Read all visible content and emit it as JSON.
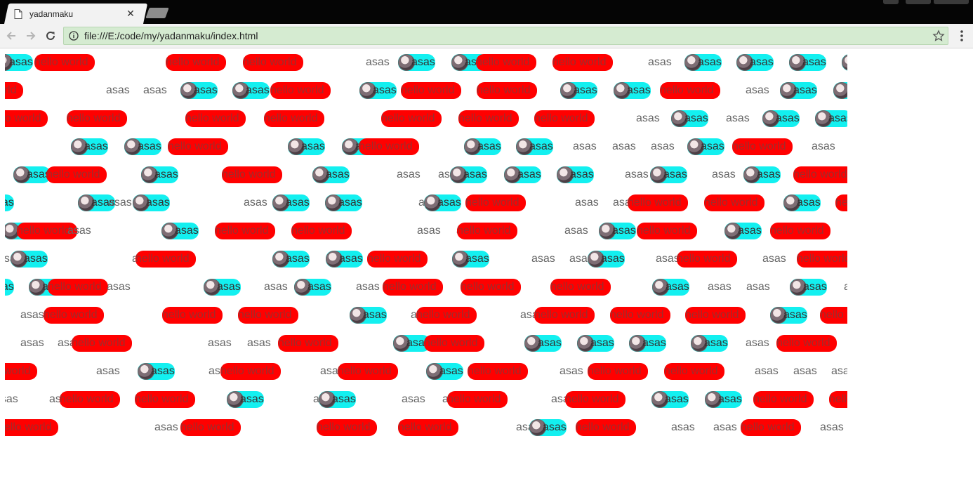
{
  "browser": {
    "tab_title": "yadanmaku",
    "url": "file:///E:/code/my/yadanmaku/index.html",
    "icons": {
      "back": "arrow-left-icon",
      "forward": "arrow-right-icon",
      "reload": "reload-icon",
      "info": "info-icon",
      "star": "star-icon",
      "menu": "menu-icon",
      "close": "close-icon",
      "page": "document-icon"
    },
    "colors": {
      "address_bar": "#d5ebd1"
    }
  },
  "danmaku": {
    "labels": {
      "red": "hello world",
      "cyan": "asas",
      "plain": "asas"
    },
    "colors": {
      "red": "#ff0000",
      "cyan": "#13f0f0",
      "plain_text": "#666666"
    },
    "rows": [
      [
        [
          "c",
          -13
        ],
        [
          "r",
          42
        ],
        [
          "r",
          229
        ],
        [
          "r",
          339
        ],
        [
          "p",
          514
        ],
        [
          "c",
          560
        ],
        [
          "c",
          636
        ],
        [
          "r",
          671
        ],
        [
          "r",
          780
        ],
        [
          "p",
          916
        ],
        [
          "c",
          968
        ],
        [
          "c",
          1042
        ],
        [
          "c",
          1117
        ],
        [
          "c",
          1192
        ]
      ],
      [
        [
          "r",
          -60
        ],
        [
          "p",
          144
        ],
        [
          "p",
          197
        ],
        [
          "c",
          250
        ],
        [
          "c",
          324
        ],
        [
          "r",
          378
        ],
        [
          "c",
          505
        ],
        [
          "r",
          564
        ],
        [
          "r",
          672
        ],
        [
          "c",
          791
        ],
        [
          "c",
          867
        ],
        [
          "r",
          933
        ],
        [
          "p",
          1055
        ],
        [
          "c",
          1104
        ],
        [
          "c",
          1180
        ]
      ],
      [
        [
          "r",
          -25
        ],
        [
          "r",
          88
        ],
        [
          "r",
          257
        ],
        [
          "r",
          369
        ],
        [
          "r",
          536
        ],
        [
          "r",
          646
        ],
        [
          "r",
          754
        ],
        [
          "p",
          899
        ],
        [
          "c",
          949
        ],
        [
          "p",
          1027
        ],
        [
          "c",
          1079
        ],
        [
          "c",
          1154
        ]
      ],
      [
        [
          "c",
          94
        ],
        [
          "c",
          170
        ],
        [
          "r",
          232
        ],
        [
          "c",
          403
        ],
        [
          "c",
          480
        ],
        [
          "r",
          504
        ],
        [
          "c",
          654
        ],
        [
          "c",
          728
        ],
        [
          "p",
          809
        ],
        [
          "p",
          865
        ],
        [
          "p",
          920
        ],
        [
          "c",
          972
        ],
        [
          "r",
          1036
        ],
        [
          "p",
          1149
        ]
      ],
      [
        [
          "c",
          12
        ],
        [
          "r",
          59
        ],
        [
          "c",
          194
        ],
        [
          "r",
          309
        ],
        [
          "c",
          438
        ],
        [
          "p",
          558
        ],
        [
          "p",
          617
        ],
        [
          "c",
          634
        ],
        [
          "c",
          711
        ],
        [
          "c",
          786
        ],
        [
          "p",
          883
        ],
        [
          "c",
          919
        ],
        [
          "p",
          1007
        ],
        [
          "c",
          1052
        ],
        [
          "r",
          1123
        ]
      ],
      [
        [
          "c",
          -40
        ],
        [
          "c",
          104
        ],
        [
          "p",
          147
        ],
        [
          "c",
          182
        ],
        [
          "p",
          340
        ],
        [
          "c",
          381
        ],
        [
          "c",
          456
        ],
        [
          "p",
          589
        ],
        [
          "c",
          597
        ],
        [
          "r",
          656
        ],
        [
          "p",
          812
        ],
        [
          "p",
          866
        ],
        [
          "r",
          887
        ],
        [
          "r",
          996
        ],
        [
          "c",
          1109
        ],
        [
          "r",
          1183
        ]
      ],
      [
        [
          "c",
          -3
        ],
        [
          "r",
          17
        ],
        [
          "p",
          89
        ],
        [
          "c",
          223
        ],
        [
          "r",
          299
        ],
        [
          "r",
          408
        ],
        [
          "p",
          587
        ],
        [
          "p",
          643
        ],
        [
          "r",
          644
        ],
        [
          "p",
          797
        ],
        [
          "c",
          846
        ],
        [
          "r",
          900
        ],
        [
          "c",
          1025
        ],
        [
          "r",
          1090
        ]
      ],
      [
        [
          "p",
          -10
        ],
        [
          "c",
          8
        ],
        [
          "p",
          181
        ],
        [
          "r",
          186
        ],
        [
          "c",
          381
        ],
        [
          "c",
          457
        ],
        [
          "r",
          516
        ],
        [
          "c",
          637
        ],
        [
          "p",
          750
        ],
        [
          "p",
          804
        ],
        [
          "c",
          830
        ],
        [
          "p",
          927
        ],
        [
          "r",
          957
        ],
        [
          "p",
          1079
        ],
        [
          "r",
          1128
        ]
      ],
      [
        [
          "c",
          -40
        ],
        [
          "c",
          34
        ],
        [
          "p",
          61
        ],
        [
          "r",
          61
        ],
        [
          "p",
          145
        ],
        [
          "c",
          283
        ],
        [
          "p",
          369
        ],
        [
          "c",
          412
        ],
        [
          "p",
          500
        ],
        [
          "r",
          538
        ],
        [
          "r",
          649
        ],
        [
          "r",
          777
        ],
        [
          "c",
          922
        ],
        [
          "p",
          1001
        ],
        [
          "p",
          1056
        ],
        [
          "c",
          1118
        ],
        [
          "p",
          1195
        ]
      ],
      [
        [
          "p",
          22
        ],
        [
          "r",
          55
        ],
        [
          "r",
          224
        ],
        [
          "r",
          332
        ],
        [
          "c",
          491
        ],
        [
          "p",
          578
        ],
        [
          "r",
          586
        ],
        [
          "p",
          734
        ],
        [
          "r",
          754
        ],
        [
          "r",
          862
        ],
        [
          "r",
          969
        ],
        [
          "c",
          1090
        ],
        [
          "r",
          1161
        ]
      ],
      [
        [
          "p",
          22
        ],
        [
          "p",
          75
        ],
        [
          "r",
          95
        ],
        [
          "p",
          289
        ],
        [
          "p",
          345
        ],
        [
          "r",
          389
        ],
        [
          "c",
          553
        ],
        [
          "r",
          597
        ],
        [
          "c",
          740
        ],
        [
          "c",
          815
        ],
        [
          "c",
          889
        ],
        [
          "c",
          977
        ],
        [
          "p",
          1055
        ],
        [
          "r",
          1099
        ]
      ],
      [
        [
          "r",
          -40
        ],
        [
          "p",
          130
        ],
        [
          "c",
          189
        ],
        [
          "p",
          290
        ],
        [
          "r",
          307
        ],
        [
          "p",
          449
        ],
        [
          "r",
          474
        ],
        [
          "c",
          600
        ],
        [
          "r",
          659
        ],
        [
          "p",
          790
        ],
        [
          "r",
          830
        ],
        [
          "r",
          939
        ],
        [
          "p",
          1068
        ],
        [
          "p",
          1123
        ],
        [
          "p",
          1177
        ]
      ],
      [
        [
          "p",
          -15
        ],
        [
          "p",
          63
        ],
        [
          "r",
          78
        ],
        [
          "r",
          185
        ],
        [
          "c",
          316
        ],
        [
          "p",
          439
        ],
        [
          "c",
          447
        ],
        [
          "p",
          565
        ],
        [
          "p",
          623
        ],
        [
          "r",
          630
        ],
        [
          "p",
          778
        ],
        [
          "r",
          798
        ],
        [
          "c",
          921
        ],
        [
          "c",
          997
        ],
        [
          "r",
          1066
        ],
        [
          "r",
          1174
        ]
      ],
      [
        [
          "r",
          -10
        ],
        [
          "p",
          213
        ],
        [
          "r",
          250
        ],
        [
          "r",
          444
        ],
        [
          "r",
          560
        ],
        [
          "p",
          728
        ],
        [
          "c",
          747
        ],
        [
          "r",
          813
        ],
        [
          "p",
          949
        ],
        [
          "p",
          1009
        ],
        [
          "r",
          1048
        ],
        [
          "p",
          1161
        ]
      ]
    ]
  }
}
